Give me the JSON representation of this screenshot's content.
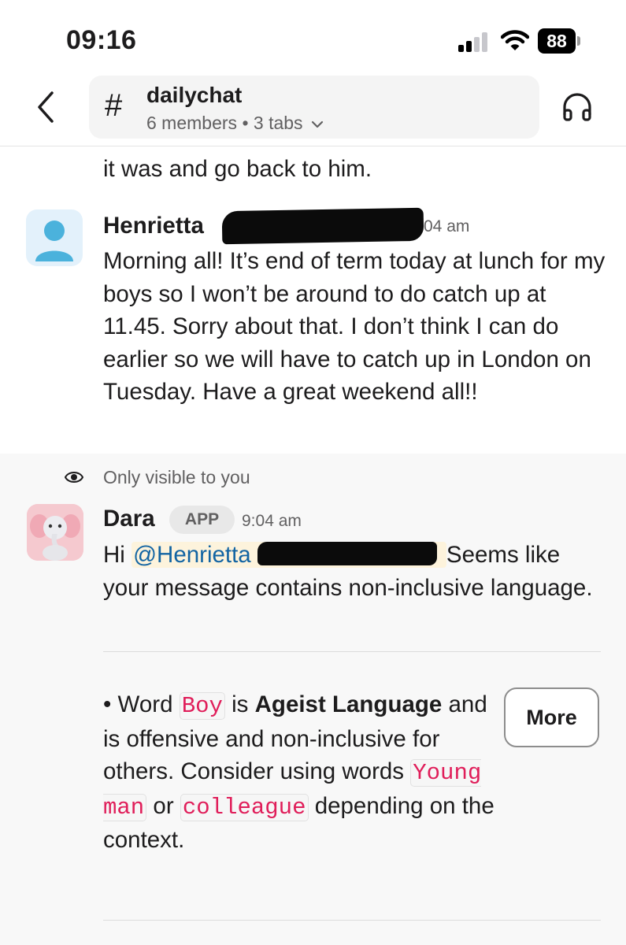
{
  "status_bar": {
    "time": "09:16",
    "battery": "88"
  },
  "header": {
    "channel_hash": "#",
    "channel_name": "dailychat",
    "members": "6 members",
    "separator": "•",
    "tabs": "3 tabs"
  },
  "messages": {
    "previous_tail": "it was and go back to him.",
    "henrietta": {
      "name": "Henrietta",
      "time_visible": "04 am",
      "body": "Morning all! It’s end of term today at lunch for my boys so I won’t be around to do catch up at 11.45. Sorry about that. I don’t think I can do earlier so we will have to catch up in London on Tuesday. Have a great weekend all!!"
    },
    "ephemeral_label": "Only visible to you",
    "dara": {
      "name": "Dara",
      "badge": "APP",
      "time": "9:04 am",
      "greeting": "Hi",
      "mention": "@Henrietta",
      "body_after_mention": "Seems like your message contains non-inclusive language.",
      "bullet": "•",
      "word_prefix": "Word",
      "word": "Boy",
      "is_text": "is",
      "category": "Ageist Language",
      "explanation": "and is offensive and non-inclusive for others. Consider using words",
      "suggestion_1": "Young man",
      "or_text": "or",
      "suggestion_2": "colleague",
      "suffix": "depending on the context.",
      "more_button": "More"
    }
  },
  "colors": {
    "mention_text": "#1264a3",
    "code_text": "#e01e5a",
    "ephemeral_bg": "#f8f8f8"
  },
  "icons": [
    "back-chevron-icon",
    "hash-icon",
    "chevron-down-icon",
    "headphones-icon",
    "eye-icon",
    "signal-icon",
    "wifi-icon",
    "battery-icon"
  ]
}
